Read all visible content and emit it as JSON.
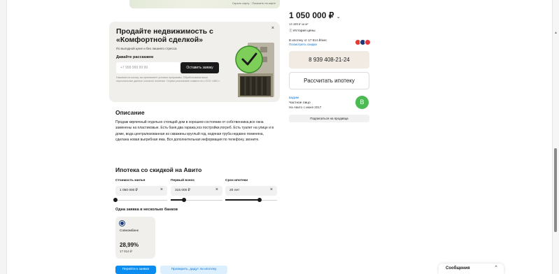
{
  "map": {
    "link": "Скрыть карту · Показать на карте"
  },
  "promo": {
    "title": "Продайте недвижимость с «Комфортной сделкой»",
    "subtitle": "По выгодной цене и без лишнего стресса",
    "ask": "Давайте расскажем",
    "phone_placeholder": "+7 999 999 99 99",
    "button": "Оставить заявку",
    "legal": "Нажимая на кнопку, вы принимаете условия программы. Обработываем ваши персональные данные согласно политике. Сервис реализован совместно с ООО «АВС».",
    "close": "×"
  },
  "description": {
    "title": "Описание",
    "text": "Продам кирпичный отдельно стоящий дом в хорошем состоянии от собственника,все окна заменены на пластиковые. Есть баня,два гаража,хоз постройки,погреб. Есть туалет на улице и в доме, вода централизованная из скважины круглый год, водяная труба недавно поменяна, сделана новая выгребная яма. Вся дополнительная информация по телефону, звоните."
  },
  "mortgage": {
    "title": "Ипотека со скидкой на Авито",
    "fields": [
      {
        "label": "Стоимость жилья",
        "value": "1 050 000 ₽",
        "clear": "×",
        "fill": 0.0
      },
      {
        "label": "Первый взнос",
        "value": "315 000 ₽",
        "clear": "×",
        "fill": 0.25
      },
      {
        "label": "Срок ипотеки",
        "value": "20 лет",
        "clear": "×",
        "fill": 0.66
      }
    ],
    "banks_title": "Одна заявка в несколько банков",
    "bank": {
      "name": "Совкомбанк",
      "rate": "28,99%",
      "payment": "17 814 ₽"
    },
    "apply_button": "Перейти к заявке",
    "check_button": "Проверить, дадут ли ипотеку"
  },
  "sidebar": {
    "price": "1 050 000 ₽",
    "price_chevron": "⌄",
    "per_meter": "14 189 ₽ за м²",
    "history": "Ⓘ История цены",
    "mortgage_from": "В ипотеку от 17 814 ₽/мес",
    "mortgage_link": "Посмотреть скидки",
    "phone": "8 939 408-21-24",
    "calc": "Рассчитать ипотеку",
    "seller_name": "вадим",
    "seller_type": "Частное лицо",
    "seller_since": "На Авито с июня 2017",
    "avatar_letter": "В",
    "subscribe": "Подписаться на продавца"
  },
  "messages": {
    "label": "Сообщения",
    "toggle": "⌃"
  },
  "colors": {
    "accent": "#0a8cf0",
    "avatar": "#4cba52",
    "phone_bg": "#f1ebe3",
    "promo_bg": "#f1efec"
  }
}
